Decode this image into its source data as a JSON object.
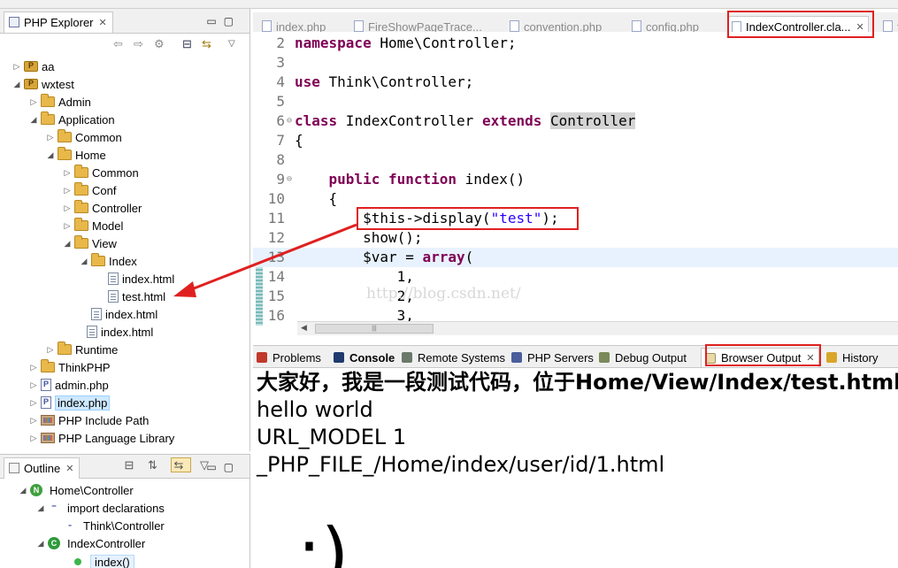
{
  "explorer": {
    "title": "PHP Explorer",
    "items": [
      {
        "label": "aa"
      },
      {
        "label": "wxtest"
      },
      {
        "label": "Admin"
      },
      {
        "label": "Application"
      },
      {
        "label": "Common"
      },
      {
        "label": "Home"
      },
      {
        "label": "Common"
      },
      {
        "label": "Conf"
      },
      {
        "label": "Controller"
      },
      {
        "label": "Model"
      },
      {
        "label": "View"
      },
      {
        "label": "Index"
      },
      {
        "label": "index.html"
      },
      {
        "label": "test.html"
      },
      {
        "label": "index.html"
      },
      {
        "label": "index.html"
      },
      {
        "label": "Runtime"
      },
      {
        "label": "ThinkPHP"
      },
      {
        "label": "admin.php"
      },
      {
        "label": "index.php"
      },
      {
        "label": "PHP Include Path"
      },
      {
        "label": "PHP Language Library"
      }
    ]
  },
  "outline": {
    "title": "Outline",
    "items": [
      {
        "label": "Home\\Controller"
      },
      {
        "label": "import declarations"
      },
      {
        "label": "Think\\Controller"
      },
      {
        "label": "IndexController"
      },
      {
        "label": "index()"
      }
    ]
  },
  "editor_tabs": [
    {
      "label": "index.php"
    },
    {
      "label": "FireShowPageTrace..."
    },
    {
      "label": "convention.php"
    },
    {
      "label": "config.php"
    },
    {
      "label": "IndexController.cla..."
    },
    {
      "label": "f"
    }
  ],
  "code_lines": [
    {
      "n": "2",
      "parts": [
        {
          "t": "namespace",
          "c": "kw"
        },
        {
          "t": " Home\\Controller;",
          "c": ""
        }
      ]
    },
    {
      "n": "3",
      "parts": []
    },
    {
      "n": "4",
      "parts": [
        {
          "t": "use",
          "c": "kw"
        },
        {
          "t": " Think\\Controller;",
          "c": ""
        }
      ]
    },
    {
      "n": "5",
      "parts": []
    },
    {
      "n": "6",
      "parts": [
        {
          "t": "class",
          "c": "kw"
        },
        {
          "t": " IndexController ",
          "c": ""
        },
        {
          "t": "extends",
          "c": "kw"
        },
        {
          "t": " ",
          "c": ""
        },
        {
          "t": "Controller",
          "c": "hl"
        }
      ]
    },
    {
      "n": "7",
      "parts": [
        {
          "t": "{",
          "c": ""
        }
      ]
    },
    {
      "n": "8",
      "parts": []
    },
    {
      "n": "9",
      "parts": [
        {
          "t": "    ",
          "c": ""
        },
        {
          "t": "public",
          "c": "kw"
        },
        {
          "t": " ",
          "c": ""
        },
        {
          "t": "function",
          "c": "kw"
        },
        {
          "t": " index()",
          "c": ""
        }
      ]
    },
    {
      "n": "10",
      "parts": [
        {
          "t": "    {",
          "c": ""
        }
      ]
    },
    {
      "n": "11",
      "parts": [
        {
          "t": "        $this->display(",
          "c": ""
        },
        {
          "t": "\"test\"",
          "c": "str"
        },
        {
          "t": ");",
          "c": ""
        }
      ]
    },
    {
      "n": "12",
      "parts": [
        {
          "t": "        show();",
          "c": ""
        }
      ]
    },
    {
      "n": "13",
      "parts": [
        {
          "t": "        $var = ",
          "c": ""
        },
        {
          "t": "array",
          "c": "kw"
        },
        {
          "t": "(",
          "c": ""
        }
      ]
    },
    {
      "n": "14",
      "parts": [
        {
          "t": "            1,",
          "c": ""
        }
      ]
    },
    {
      "n": "15",
      "parts": [
        {
          "t": "            2,",
          "c": ""
        }
      ]
    },
    {
      "n": "16",
      "parts": [
        {
          "t": "            3,",
          "c": ""
        }
      ]
    }
  ],
  "watermark": "http://blog.csdn.net/",
  "bottom_tabs": [
    {
      "label": "Problems"
    },
    {
      "label": "Console"
    },
    {
      "label": "Remote Systems"
    },
    {
      "label": "PHP Servers"
    },
    {
      "label": "Debug Output"
    },
    {
      "label": "Browser Output"
    },
    {
      "label": "History"
    }
  ],
  "browser_output": {
    "lines": [
      "大家好，我是一段测试代码，位于Home/View/Index/test.html",
      "hello world",
      "URL_MODEL 1",
      "_PHP_FILE_/Home/index/user/id/1.html"
    ],
    "smiley": ":)"
  },
  "colors": {
    "annotation": "#e02020",
    "keyword": "#7f0055",
    "string": "#2a00ff"
  }
}
